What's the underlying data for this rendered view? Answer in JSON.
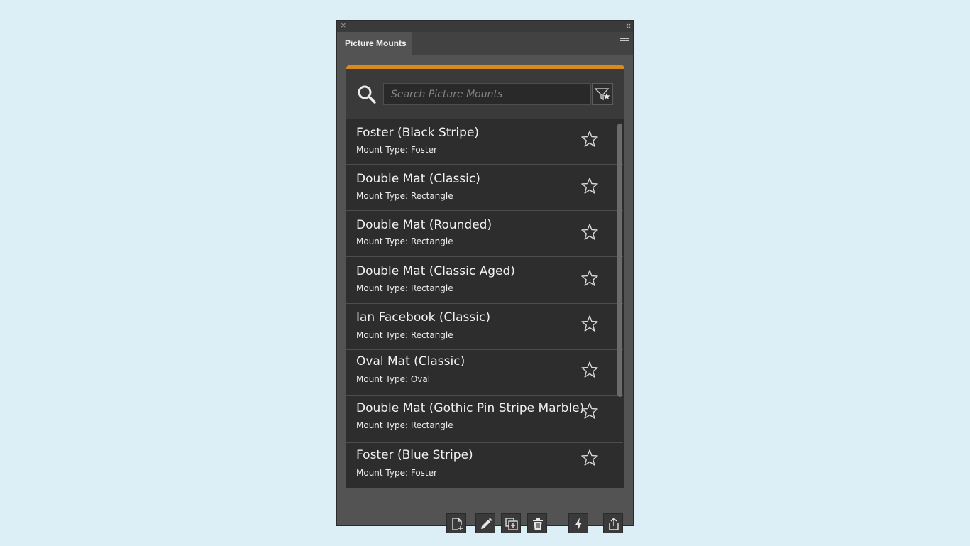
{
  "panel": {
    "title": "Picture Mounts",
    "close_glyph": "×",
    "collapse_glyph": "«",
    "accent_color": "#d98a1a"
  },
  "search": {
    "placeholder": "Search Picture Mounts",
    "value": ""
  },
  "mounts": [
    {
      "name": "Foster (Black Stripe)",
      "type": "Mount Type: Foster",
      "favorite": false
    },
    {
      "name": "Double Mat (Classic)",
      "type": "Mount Type: Rectangle",
      "favorite": false
    },
    {
      "name": "Double Mat (Rounded)",
      "type": "Mount Type: Rectangle",
      "favorite": false
    },
    {
      "name": "Double Mat (Classic Aged)",
      "type": "Mount Type: Rectangle",
      "favorite": false
    },
    {
      "name": "Ian Facebook (Classic)",
      "type": "Mount Type: Rectangle",
      "favorite": false
    },
    {
      "name": "Oval Mat (Classic)",
      "type": "Mount Type: Oval",
      "favorite": false
    },
    {
      "name": "Double Mat (Gothic Pin Stripe Marble)",
      "type": "Mount Type: Rectangle",
      "favorite": false
    },
    {
      "name": "Foster (Blue Stripe)",
      "type": "Mount Type: Foster",
      "favorite": false
    }
  ],
  "footer": {
    "buttons": [
      "new-document-icon",
      "edit-pencil-icon",
      "duplicate-icon",
      "trash-icon",
      "lightning-icon",
      "share-export-icon"
    ]
  }
}
